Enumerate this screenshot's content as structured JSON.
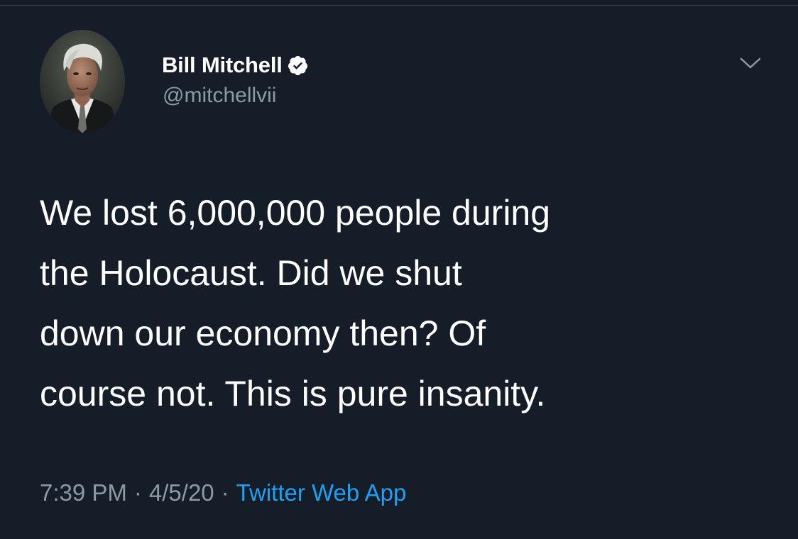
{
  "tweet": {
    "author": {
      "display_name": "Bill Mitchell",
      "handle": "@mitchellvii",
      "verified": true
    },
    "text_lines": [
      "We lost 6,000,000 people during",
      "the Holocaust. Did we shut",
      "down our economy then? Of",
      "course not. This is pure insanity."
    ],
    "meta": {
      "time": "7:39 PM",
      "separator": "·",
      "date": "4/5/20",
      "source": "Twitter Web App"
    }
  },
  "colors": {
    "background": "#151d29",
    "text_primary": "#ffffff",
    "text_secondary": "#8e99a6",
    "link": "#1da1f2"
  },
  "icons": {
    "verified": "verified-badge-icon",
    "menu": "chevron-down-icon"
  }
}
